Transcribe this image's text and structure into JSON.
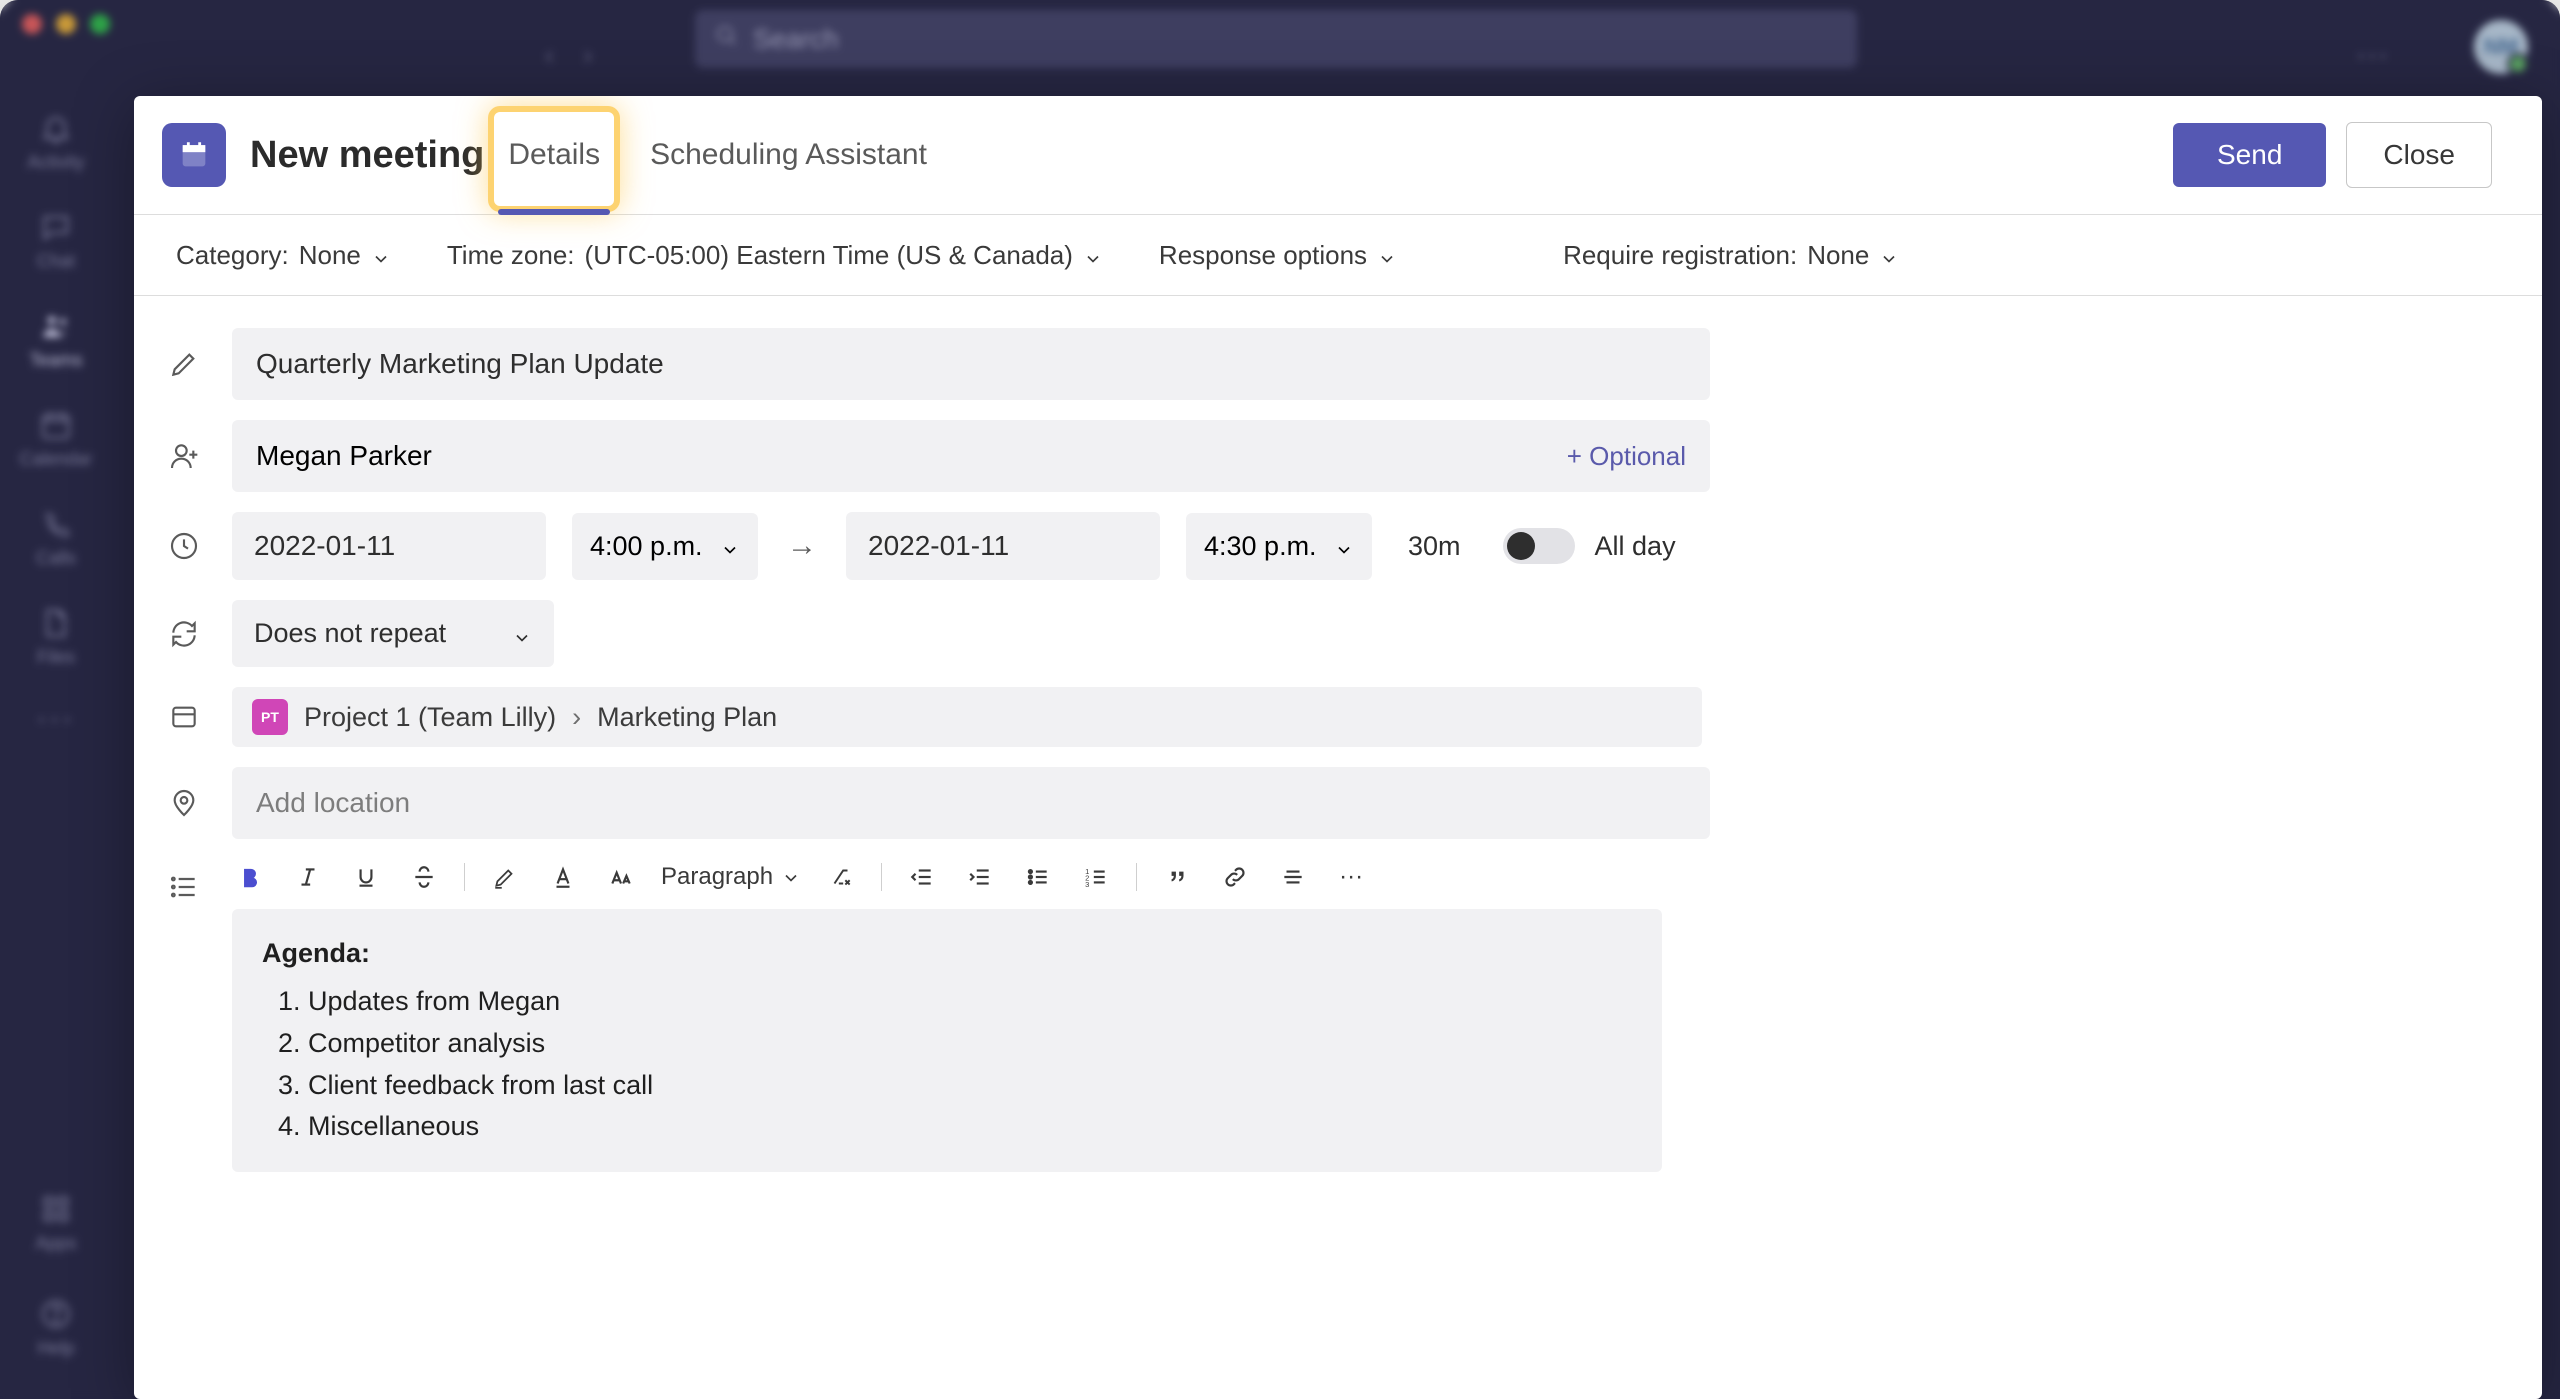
{
  "search": {
    "placeholder": "Search"
  },
  "avatar": {
    "initials": "NM"
  },
  "rail": {
    "activity": "Activity",
    "chat": "Chat",
    "teams": "Teams",
    "calendar": "Calendar",
    "calls": "Calls",
    "files": "Files",
    "apps": "Apps",
    "help": "Help"
  },
  "modal": {
    "title": "New meeting",
    "tabs": {
      "details": "Details",
      "scheduling": "Scheduling Assistant"
    },
    "buttons": {
      "send": "Send",
      "close": "Close"
    }
  },
  "options": {
    "category_label": "Category:",
    "category_value": "None",
    "timezone_label": "Time zone:",
    "timezone_value": "(UTC-05:00) Eastern Time (US & Canada)",
    "response_label": "Response options",
    "registration_label": "Require registration:",
    "registration_value": "None"
  },
  "form": {
    "title_value": "Quarterly Marketing Plan Update",
    "attendees_value": "Megan Parker",
    "optional_label": "+ Optional",
    "start_date": "2022-01-11",
    "start_time": "4:00 p.m.",
    "end_date": "2022-01-11",
    "end_time": "4:30 p.m.",
    "duration": "30m",
    "all_day_label": "All day",
    "recurrence": "Does not repeat",
    "channel_chip": "PT",
    "channel_team": "Project 1 (Team Lilly)",
    "channel_name": "Marketing Plan",
    "location_placeholder": "Add location"
  },
  "toolbar": {
    "paragraph": "Paragraph"
  },
  "agenda": {
    "heading": "Agenda:",
    "items": [
      "Updates from Megan",
      "Competitor analysis",
      "Client feedback from last call",
      "Miscellaneous"
    ]
  }
}
